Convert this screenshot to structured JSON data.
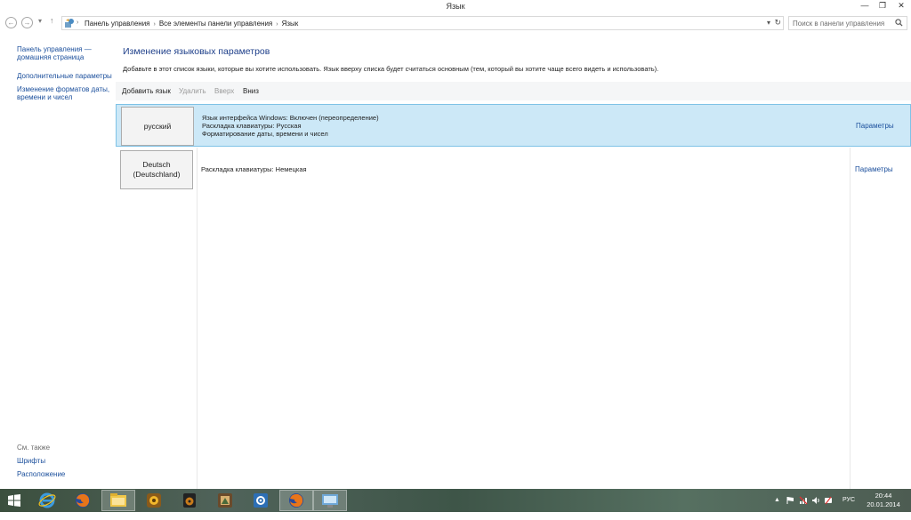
{
  "window": {
    "title": "Язык",
    "minimize": "—",
    "maximize": "❐",
    "close": "✕"
  },
  "address_bar": {
    "breadcrumbs": [
      "Панель управления",
      "Все элементы панели управления",
      "Язык"
    ],
    "search_placeholder": "Поиск в панели управления"
  },
  "left_pane": {
    "links": [
      {
        "label": "Панель управления — домашняя страница"
      },
      {
        "label": "Дополнительные параметры"
      },
      {
        "label": "Изменение форматов даты, времени и чисел"
      }
    ],
    "see_also_title": "См. также",
    "see_also_links": [
      {
        "label": "Шрифты"
      },
      {
        "label": "Расположение"
      }
    ]
  },
  "main": {
    "heading": "Изменение языковых параметров",
    "description": "Добавьте в этот список языки, которые вы хотите использовать. Язык вверху списка будет считаться основным (тем, который вы хотите чаще всего видеть и использовать).",
    "toolbar": {
      "add": "Добавить язык",
      "remove": "Удалить",
      "up": "Вверх",
      "down": "Вниз"
    },
    "languages": [
      {
        "name": "русский",
        "details": [
          "Язык интерфейса Windows: Включен (переопределение)",
          "Раскладка клавиатуры: Русская",
          "Форматирование даты, времени и чисел"
        ],
        "params_label": "Параметры",
        "selected": true
      },
      {
        "name": "Deutsch (Deutschland)",
        "details": [
          "Раскладка клавиатуры: Немецкая"
        ],
        "params_label": "Параметры",
        "selected": false
      }
    ]
  },
  "taskbar": {
    "language_indicator": "РУС",
    "time": "20:44",
    "date": "20.01.2014"
  },
  "colors": {
    "accent_link": "#1b4f9c",
    "selection": "#cce8f7",
    "heading": "#1e3f8a"
  }
}
